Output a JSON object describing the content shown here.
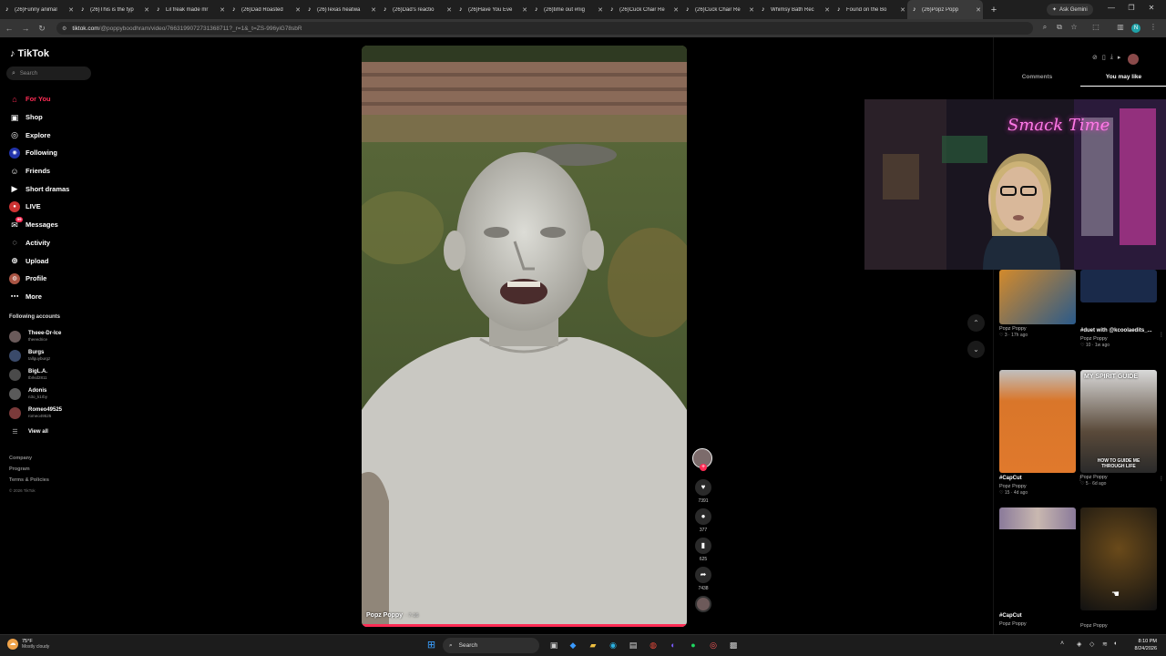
{
  "browser": {
    "tabs": [
      {
        "title": "(26)Funny animal"
      },
      {
        "title": "(26)This is the typ"
      },
      {
        "title": "Lil freak made mr"
      },
      {
        "title": "(26)Dad Roasted"
      },
      {
        "title": "(26)Texas heatwa"
      },
      {
        "title": "(26)Dad's reactio"
      },
      {
        "title": "(26)Have You Eve"
      },
      {
        "title": "(26)time out #nig"
      },
      {
        "title": "(26)Cuck Chair Re"
      },
      {
        "title": "(26)Cuck Chair Re"
      },
      {
        "title": "Whimsy Bath Rec"
      },
      {
        "title": "Found on the Bo"
      },
      {
        "title": "(26)Popz Popp"
      }
    ],
    "new_tab": "+",
    "ask_gemini": "Ask Gemini",
    "url_host": "tiktok.com",
    "url_path": "/@poppyboodhram/video/7663199072731368711?_r=1&_t=ZS-996yiG78sbR",
    "profile_initial": "N"
  },
  "tiktok": {
    "logo_text": "TikTok",
    "search_placeholder": "Search",
    "nav": [
      {
        "label": "For You",
        "icon": "home-icon"
      },
      {
        "label": "Shop",
        "icon": "shop-icon"
      },
      {
        "label": "Explore",
        "icon": "compass-icon"
      },
      {
        "label": "Following",
        "icon": "following-icon"
      },
      {
        "label": "Friends",
        "icon": "friends-icon"
      },
      {
        "label": "Short dramas",
        "icon": "drama-icon"
      },
      {
        "label": "LIVE",
        "icon": "live-icon"
      },
      {
        "label": "Messages",
        "icon": "messages-icon",
        "badge": "99"
      },
      {
        "label": "Activity",
        "icon": "activity-icon"
      },
      {
        "label": "Upload",
        "icon": "upload-icon"
      },
      {
        "label": "Profile",
        "icon": "profile-icon"
      },
      {
        "label": "More",
        "icon": "more-icon"
      }
    ],
    "following_title": "Following accounts",
    "accounts": [
      {
        "name": "Theee-Dr-Ice",
        "handle": "theeedrice"
      },
      {
        "name": "Burgs",
        "handle": "tallguyburgz"
      },
      {
        "name": "BigL.A.",
        "handle": "tbrkid2811"
      },
      {
        "name": "Adonis",
        "handle": "n3o_k1rby"
      },
      {
        "name": "Romeo49525",
        "handle": "romeo49525"
      }
    ],
    "view_all": "View all",
    "footer": {
      "company": "Company",
      "program": "Program",
      "terms": "Terms & Policies",
      "copyright": "© 2026 TikTok"
    },
    "video": {
      "author": "Popz Poppy",
      "time": "· 7-16",
      "progress": 1.0
    },
    "actions": {
      "likes": "7391",
      "comments": "377",
      "saves": "625",
      "shares": "7438"
    },
    "panel": {
      "tabs": [
        "Comments",
        "You may like"
      ],
      "active_tab": "You may like",
      "cards": [
        {
          "title": "",
          "author": "Popz Poppy",
          "meta": "♡ 3 · 17h ago"
        },
        {
          "title": "#duet with @kcoolaedits_...",
          "author": "Popz Poppy",
          "meta": "♡ 10 · 1w ago"
        },
        {
          "title": "#CapCut",
          "author": "Popz Poppy",
          "meta": "♡ 15 · 4d ago"
        },
        {
          "title": "",
          "author": "Popz Poppy",
          "meta": "♡ 5 · 6d ago",
          "overlay_top": "MY SPIRIT GUIDE",
          "overlay_bottom": "HOW TO GUIDE ME THROUGH LIFE"
        },
        {
          "title": "#CapCut",
          "author": "Popz Poppy",
          "meta": ""
        },
        {
          "title": "",
          "author": "Popz Poppy",
          "meta": ""
        }
      ],
      "webcam_neon": "Smack Time"
    }
  },
  "taskbar": {
    "temp": "75°F",
    "condition": "Mostly cloudy",
    "search": "Search",
    "time": "8:10 PM",
    "date": "8/24/2026"
  }
}
